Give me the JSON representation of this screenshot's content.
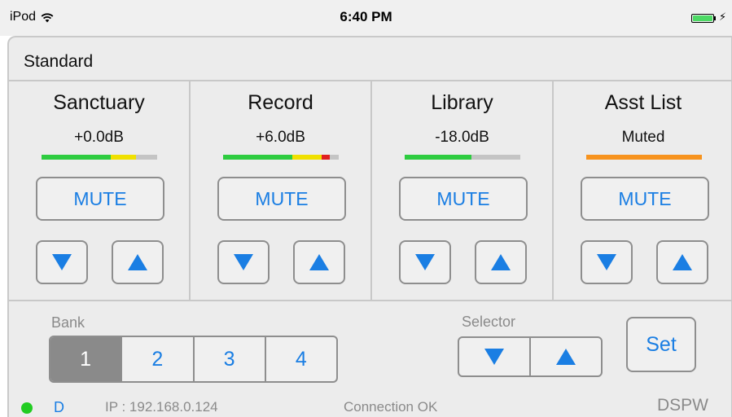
{
  "status_bar": {
    "device": "iPod",
    "time": "6:40 PM",
    "wifi_icon": "wifi-icon",
    "battery_icon": "battery-icon",
    "battery_level": 1.0
  },
  "colors": {
    "accent": "#1a7ee3",
    "meter_green": "#2ecc40",
    "meter_yellow": "#f0e000",
    "meter_red": "#e02020",
    "meter_orange": "#f7931e",
    "meter_empty": "#c4c4c4",
    "status_ok": "#22cc22"
  },
  "header": {
    "title": "Standard"
  },
  "channels": [
    {
      "name": "Sanctuary",
      "level": "+0.0dB",
      "mute_label": "MUTE",
      "meter": [
        {
          "color": "green",
          "fraction": 0.6
        },
        {
          "color": "yellow",
          "fraction": 0.22
        }
      ]
    },
    {
      "name": "Record",
      "level": "+6.0dB",
      "mute_label": "MUTE",
      "meter": [
        {
          "color": "green",
          "fraction": 0.6
        },
        {
          "color": "yellow",
          "fraction": 0.25
        },
        {
          "color": "red",
          "fraction": 0.07
        }
      ]
    },
    {
      "name": "Library",
      "level": "-18.0dB",
      "mute_label": "MUTE",
      "meter": [
        {
          "color": "green",
          "fraction": 0.58
        }
      ]
    },
    {
      "name": "Asst List",
      "level": "Muted",
      "mute_label": "MUTE",
      "meter": [
        {
          "color": "orange",
          "fraction": 1.0
        }
      ]
    }
  ],
  "bank": {
    "label": "Bank",
    "items": [
      "1",
      "2",
      "3",
      "4"
    ],
    "selected": "1"
  },
  "selector": {
    "label": "Selector",
    "down_icon": "triangle-down-icon",
    "up_icon": "triangle-up-icon"
  },
  "set_label": "Set",
  "footer": {
    "indicator": "D",
    "ip": "IP : 192.168.0.124",
    "connection": "Connection OK",
    "brand": "DSPW"
  }
}
